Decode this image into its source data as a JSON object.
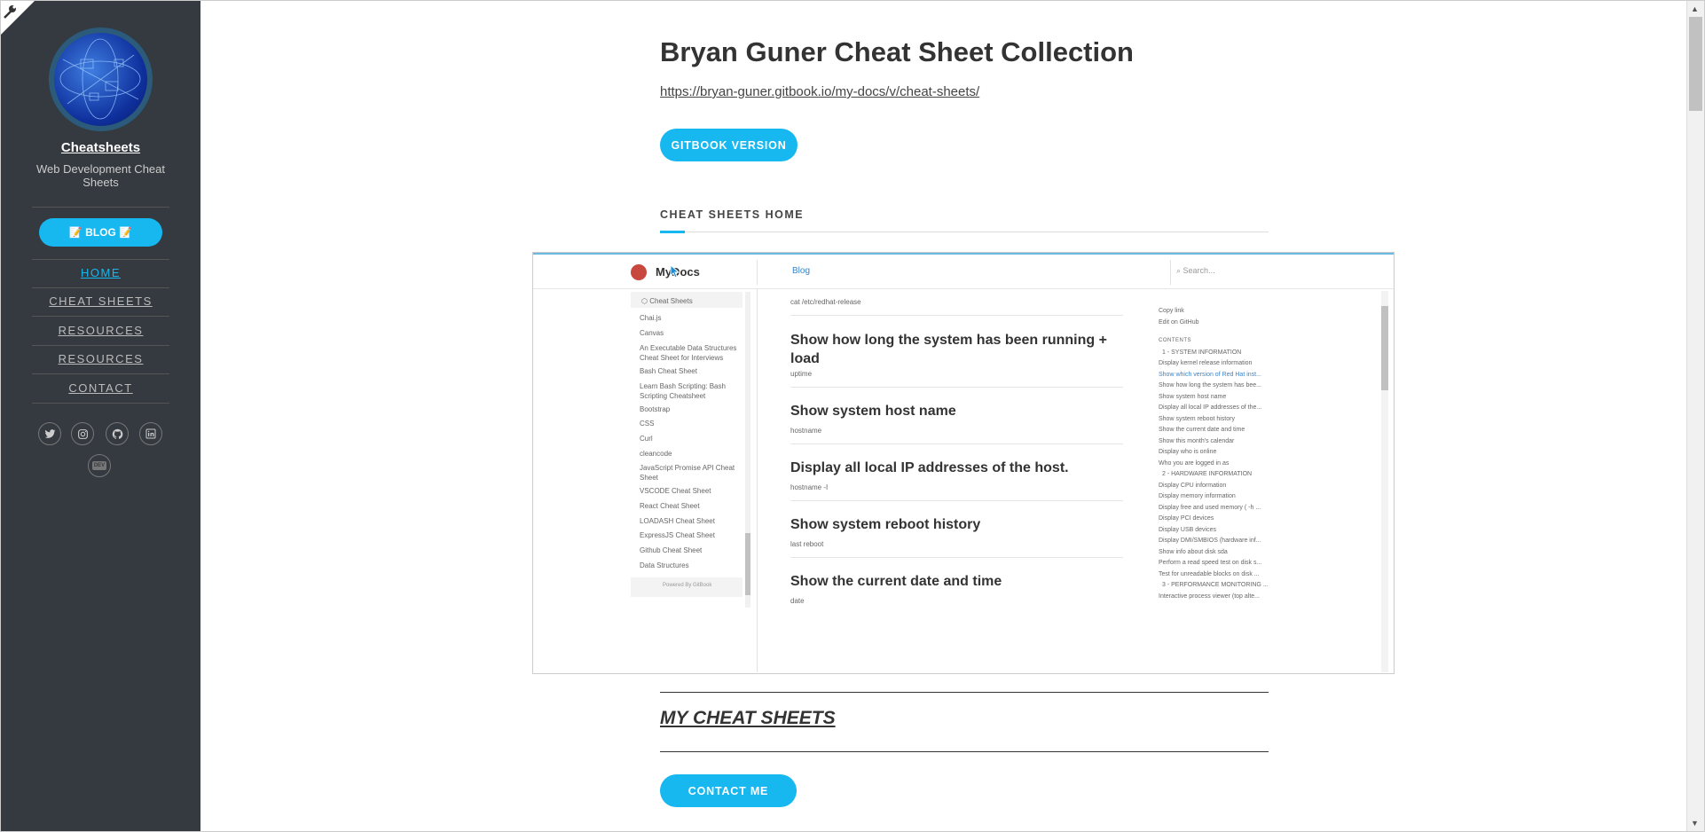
{
  "sidebar": {
    "site_title": "Cheatsheets",
    "site_subtitle": "Web Development Cheat Sheets",
    "blog_button": "📝 BLOG 📝",
    "nav": [
      {
        "label": "HOME",
        "active": true
      },
      {
        "label": "CHEAT SHEETS",
        "active": false
      },
      {
        "label": "RESOURCES",
        "active": false
      },
      {
        "label": "RESOURCES",
        "active": false
      },
      {
        "label": "CONTACT",
        "active": false
      }
    ],
    "social_icons": [
      "twitter-icon",
      "instagram-icon",
      "github-icon",
      "linkedin-icon",
      "dev-icon"
    ],
    "dev_label": "DEV"
  },
  "main": {
    "title": "Bryan Guner Cheat Sheet Collection",
    "url": "https://bryan-guner.gitbook.io/my-docs/v/cheat-sheets/",
    "gitbook_button": "GITBOOK VERSION",
    "section_label": "CHEAT SHEETS HOME",
    "my_cheat_sheets": "MY CHEAT SHEETS",
    "contact_button": "CONTACT ME"
  },
  "embedded_screenshot": {
    "logo_text": "MyDocs",
    "blog_link": "Blog",
    "search_placeholder": "Search...",
    "left_nav": [
      "Cheat Sheets",
      "Chai.js",
      "Canvas",
      "An Executable Data Structures Cheat Sheet for Interviews",
      "Bash Cheat Sheet",
      "Learn Bash Scripting: Bash Scripting Cheatsheet",
      "Bootstrap",
      "CSS",
      "Curl",
      "cleancode",
      "JavaScript Promise API Cheat Sheet",
      "VSCODE Cheat Sheet",
      "React Cheat Sheet",
      "LOADASH Cheat Sheet",
      "ExpressJS Cheat Sheet",
      "Github Cheat Sheet",
      "Data Structures",
      "Powered By GitBook"
    ],
    "content": [
      {
        "cmd": "cat /etc/redhat-release"
      },
      {
        "heading": "Show how long the system has been running + load",
        "cmd": "uptime"
      },
      {
        "heading": "Show system host name",
        "cmd": "hostname"
      },
      {
        "heading": "Display all local IP addresses of the host.",
        "cmd": "hostname -I"
      },
      {
        "heading": "Show system reboot history",
        "cmd": "last reboot"
      },
      {
        "heading": "Show the current date and time",
        "cmd": "date"
      }
    ],
    "right_nav": [
      "Copy link",
      "Edit on GitHub",
      "CONTENTS",
      "1 - SYSTEM INFORMATION",
      "Display kernel release information",
      "Show which version of Red Hat inst...",
      "Show how long the system has bee...",
      "Show system host name",
      "Display all local IP addresses of the...",
      "Show system reboot history",
      "Show the current date and time",
      "Show this month's calendar",
      "Display who is online",
      "Who you are logged in as",
      "2 - HARDWARE INFORMATION",
      "Display CPU information",
      "Display memory information",
      "Display free and used memory ( -h ...",
      "Display PCI devices",
      "Display USB devices",
      "Display DMI/SMBIOS (hardware inf...",
      "Show info about disk sda",
      "Perform a read speed test on disk s...",
      "Test for unreadable blocks on disk ...",
      "3 - PERFORMANCE MONITORING ...",
      "Interactive process viewer (top alte..."
    ]
  },
  "colors": {
    "accent": "#17b7f0",
    "sidebar_bg": "#343a40"
  }
}
